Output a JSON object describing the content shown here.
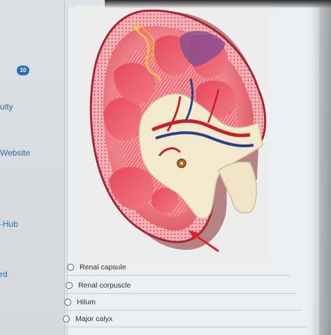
{
  "sidebar": {
    "badge": "10",
    "items": [
      "ulty",
      "Website",
      "-Hub",
      "rd"
    ]
  },
  "question": {
    "image_alt": "kidney-model-photo",
    "choices": [
      "Renal capsule",
      "Renal corpuscle",
      "Hilum",
      "Major calyx"
    ]
  },
  "colors": {
    "link": "#2f6ea8",
    "badge": "#2d6fb3",
    "arrow": "#d8242f"
  }
}
